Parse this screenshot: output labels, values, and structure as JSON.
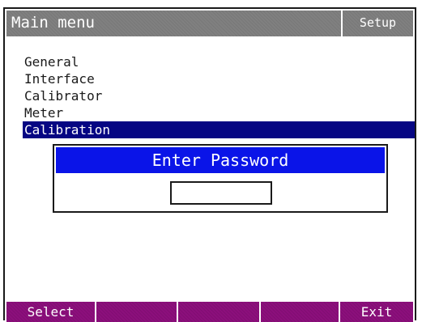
{
  "titlebar": {
    "title": "Main menu",
    "mode": "Setup"
  },
  "menu": {
    "items": [
      {
        "label": "General"
      },
      {
        "label": "Interface"
      },
      {
        "label": "Calibrator"
      },
      {
        "label": "Meter"
      },
      {
        "label": "Calibration",
        "selected": true
      }
    ]
  },
  "dialog": {
    "title": "Enter Password",
    "password_value": ""
  },
  "softkeys": [
    {
      "label": "Select"
    },
    {
      "label": ""
    },
    {
      "label": ""
    },
    {
      "label": ""
    },
    {
      "label": "Exit"
    }
  ],
  "colors": {
    "titlebar_bg": "#808080",
    "selection_bg": "#060683",
    "dialog_title_bg": "#0a14e8",
    "softkey_bg": "#8c0f7c"
  }
}
